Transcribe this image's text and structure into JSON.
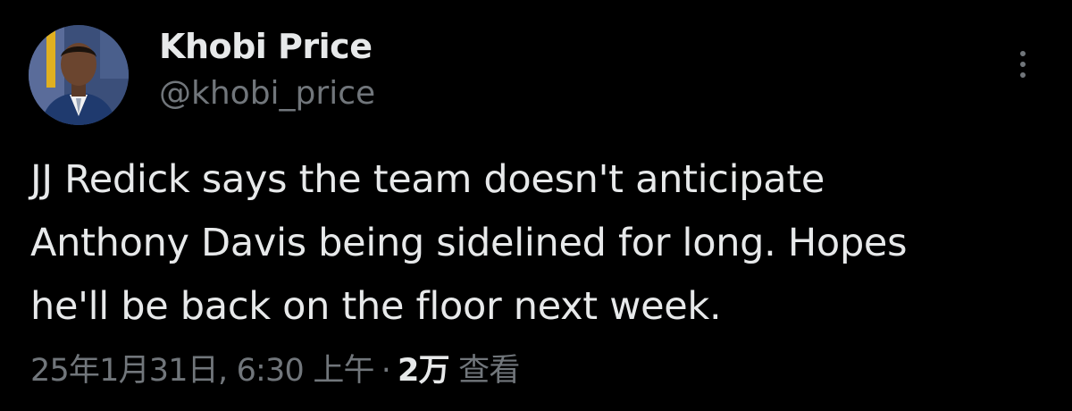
{
  "author": {
    "display_name": "Khobi Price",
    "handle": "@khobi_price"
  },
  "tweet": {
    "lines": [
      "JJ Redick says the team doesn't anticipate",
      "Anthony Davis being sidelined for long. Hopes",
      "he'll be back on the floor next week."
    ]
  },
  "meta": {
    "timestamp": "25年1月31日, 6:30 上午",
    "separator": "·",
    "views_count": "2万",
    "views_label": "查看"
  },
  "icons": {
    "more": "more-vertical-icon"
  },
  "colors": {
    "background": "#000000",
    "primary_text": "#e7e9ea",
    "secondary_text": "#71767b"
  }
}
